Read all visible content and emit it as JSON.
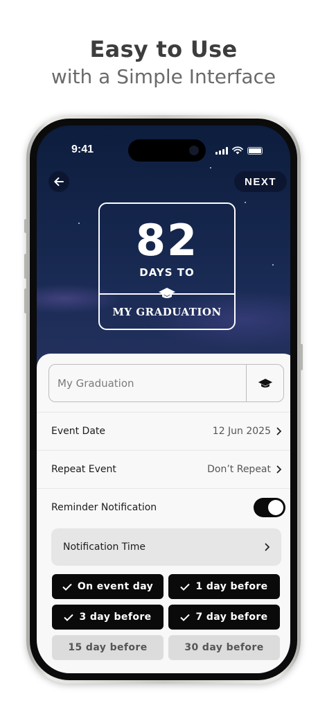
{
  "headline": "Easy to Use",
  "subheadline": "with a Simple Interface",
  "status_bar": {
    "time": "9:41"
  },
  "nav": {
    "next_label": "NEXT"
  },
  "countdown": {
    "days": "82",
    "days_to_label": "DAYS TO",
    "event_title": "MY GRADUATION"
  },
  "event_name_field": {
    "placeholder": "My Graduation",
    "value": ""
  },
  "event_date": {
    "label": "Event Date",
    "value": "12 Jun 2025"
  },
  "repeat_event": {
    "label": "Repeat Event",
    "value": "Don’t Repeat"
  },
  "reminder_notification": {
    "label": "Reminder Notification",
    "enabled": true
  },
  "notification_time": {
    "label": "Notification Time"
  },
  "reminder_options": [
    {
      "label": "On event day",
      "selected": true
    },
    {
      "label": "1 day before",
      "selected": true
    },
    {
      "label": "3 day before",
      "selected": true
    },
    {
      "label": "7 day before",
      "selected": true
    },
    {
      "label": "15 day before",
      "selected": false
    },
    {
      "label": "30 day before",
      "selected": false
    }
  ],
  "colors": {
    "accent": "#0a0a0a",
    "sheet_background": "#f8f8f8",
    "unselected_chip": "#dcdcdc",
    "headline_text": "#3d3d3d"
  },
  "icons": {
    "back": "arrow-left-icon",
    "event": "graduation-cap-icon",
    "chevron": "chevron-right-icon",
    "check": "checkmark-icon"
  }
}
